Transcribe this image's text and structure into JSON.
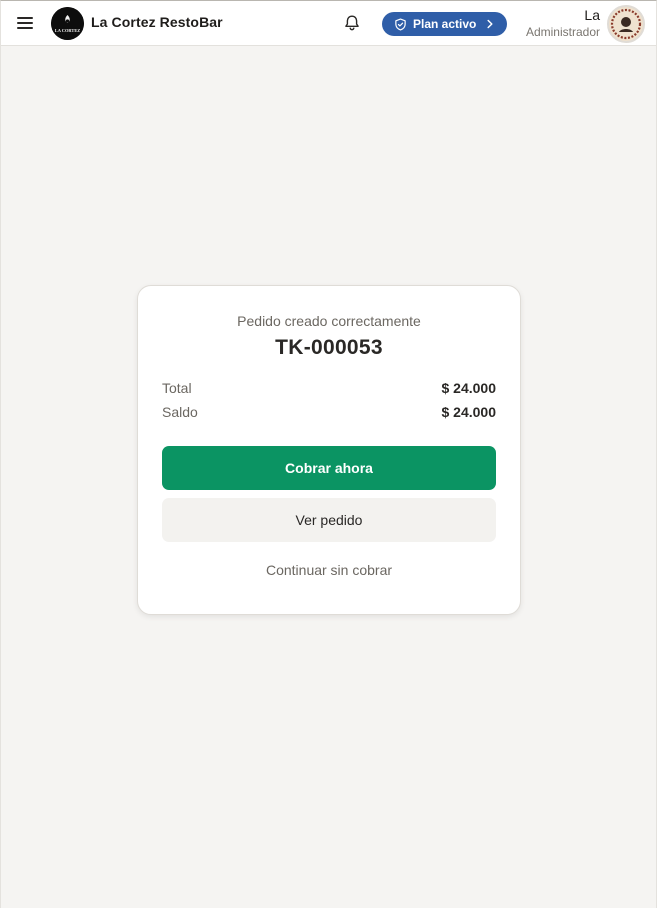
{
  "header": {
    "brand_name": "La Cortez RestoBar",
    "logo_text": "LA CORTEZ",
    "plan_label": "Plan activo",
    "user_name": "La",
    "user_role": "Administrador"
  },
  "order": {
    "subtitle": "Pedido creado correctamente",
    "ticket": "TK-000053",
    "total_label": "Total",
    "total_value": "$ 24.000",
    "saldo_label": "Saldo",
    "saldo_value": "$ 24.000"
  },
  "actions": {
    "charge_now": "Cobrar ahora",
    "view_order": "Ver pedido",
    "continue_without_charge": "Continuar sin cobrar"
  },
  "colors": {
    "primary_green": "#0b9463",
    "plan_blue": "#2f5ea8",
    "background": "#f5f4f2"
  },
  "icons": [
    "menu-icon",
    "logo",
    "bell-icon",
    "shield-check-icon",
    "chevron-right-icon",
    "avatar"
  ]
}
